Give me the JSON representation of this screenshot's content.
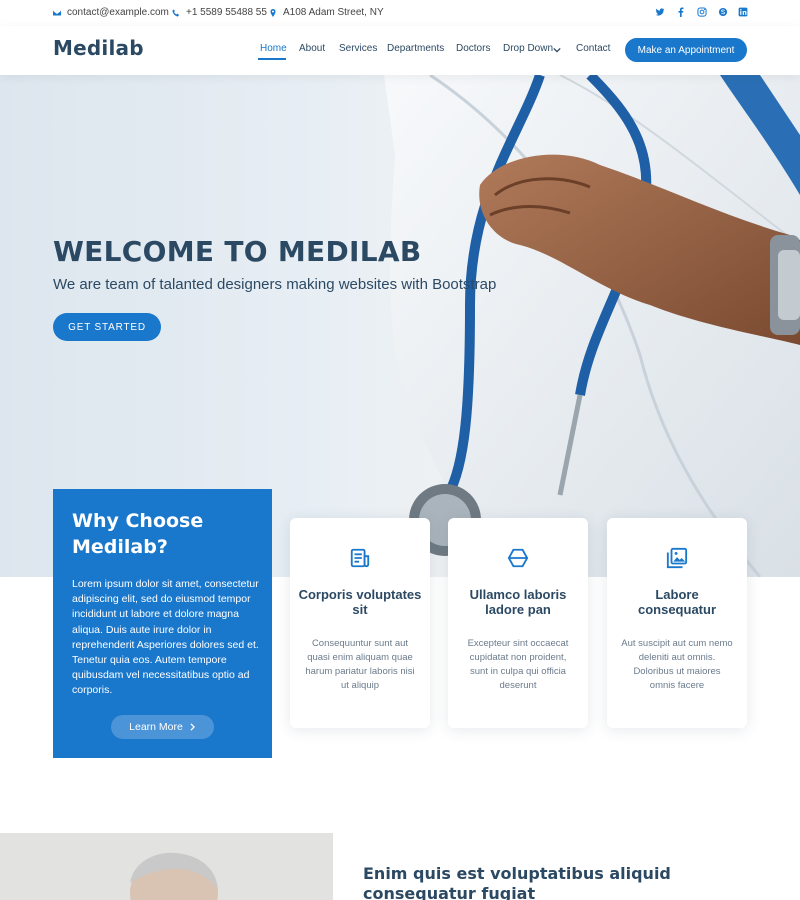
{
  "topbar": {
    "email": "contact@example.com",
    "phone": "+1 5589 55488 55",
    "address": "A108 Adam Street, NY",
    "socials": [
      "twitter-icon",
      "facebook-icon",
      "instagram-icon",
      "skype-icon",
      "linkedin-icon"
    ]
  },
  "header": {
    "logo": "Medilab",
    "nav": [
      "Home",
      "About",
      "Services",
      "Departments",
      "Doctors",
      "Drop Down",
      "Contact"
    ],
    "cta": "Make an Appointment"
  },
  "hero": {
    "title": "WELCOME TO MEDILAB",
    "subtitle": "We are team of talanted designers making websites with Bootstrap",
    "button": "GET STARTED"
  },
  "why": {
    "title": "Why Choose Medilab?",
    "body": "Lorem ipsum dolor sit amet, consectetur adipiscing elit, sed do eiusmod tempor incididunt ut labore et dolore magna aliqua. Duis aute irure dolor in reprehenderit Asperiores dolores sed et. Tenetur quia eos. Autem tempore quibusdam vel necessitatibus optio ad corporis.",
    "button": "Learn More"
  },
  "cards": [
    {
      "icon": "receipt-icon",
      "title": "Corporis voluptates sit",
      "text": "Consequuntur sunt aut quasi enim aliquam quae harum pariatur laboris nisi ut aliquip"
    },
    {
      "icon": "cube-icon",
      "title": "Ullamco laboris ladore pan",
      "text": "Excepteur sint occaecat cupidatat non proident, sunt in culpa qui officia deserunt"
    },
    {
      "icon": "images-icon",
      "title": "Labore consequatur",
      "text": "Aut suscipit aut cum nemo deleniti aut omnis. Doloribus ut maiores omnis facere"
    }
  ],
  "about": {
    "title": "Enim quis est voluptatibus aliquid consequatur fugiat"
  },
  "colors": {
    "accent": "#1977cc",
    "heading": "#2c4964"
  }
}
